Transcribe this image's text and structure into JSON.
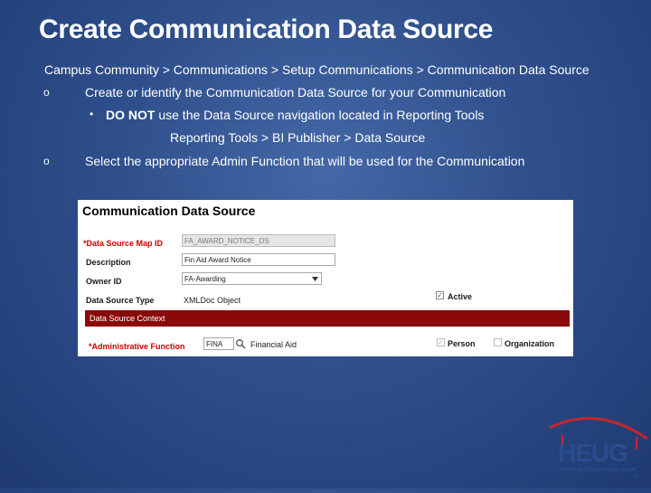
{
  "slide": {
    "title": "Create Communication Data Source",
    "breadcrumb": "Campus Community > Communications > Setup Communications > Communication Data Source",
    "bullets": [
      {
        "mark": "o",
        "text": "Create or identify the Communication Data Source for your Communication"
      },
      {
        "mark": "o",
        "text": "Select the appropriate Admin Function that will be used for the Communication"
      }
    ],
    "subbullet": {
      "mark": "•",
      "bold": "DO NOT",
      "text": " use the Data Source navigation located in Reporting Tools"
    },
    "path_line": "Reporting Tools > BI Publisher > Data Source"
  },
  "panel": {
    "title": "Communication Data Source",
    "map_id_label": "*Data Source Map ID",
    "map_id_value": "FA_AWARD_NOTICE_DS",
    "description_label": "Description",
    "description_value": "Fin Aid Award Notice",
    "owner_label": "Owner ID",
    "owner_value": "FA-Awarding",
    "type_label": "Data Source Type",
    "type_value": "XMLDoc Object",
    "active_label": "Active",
    "section_label": "Data Source Context",
    "admin_label": "*Administrative Function",
    "admin_value": "FINA",
    "admin_desc": "Financial Aid",
    "person_label": "Person",
    "organization_label": "Organization"
  },
  "logo": {
    "text": "HEUG",
    "tagline": "HIGHER EDUCATION USER GROUP",
    "tm": "TM"
  },
  "colors": {
    "section_bar": "#8a0a0a",
    "logo_red": "#c0272d",
    "logo_blue": "#2a4d8f"
  }
}
